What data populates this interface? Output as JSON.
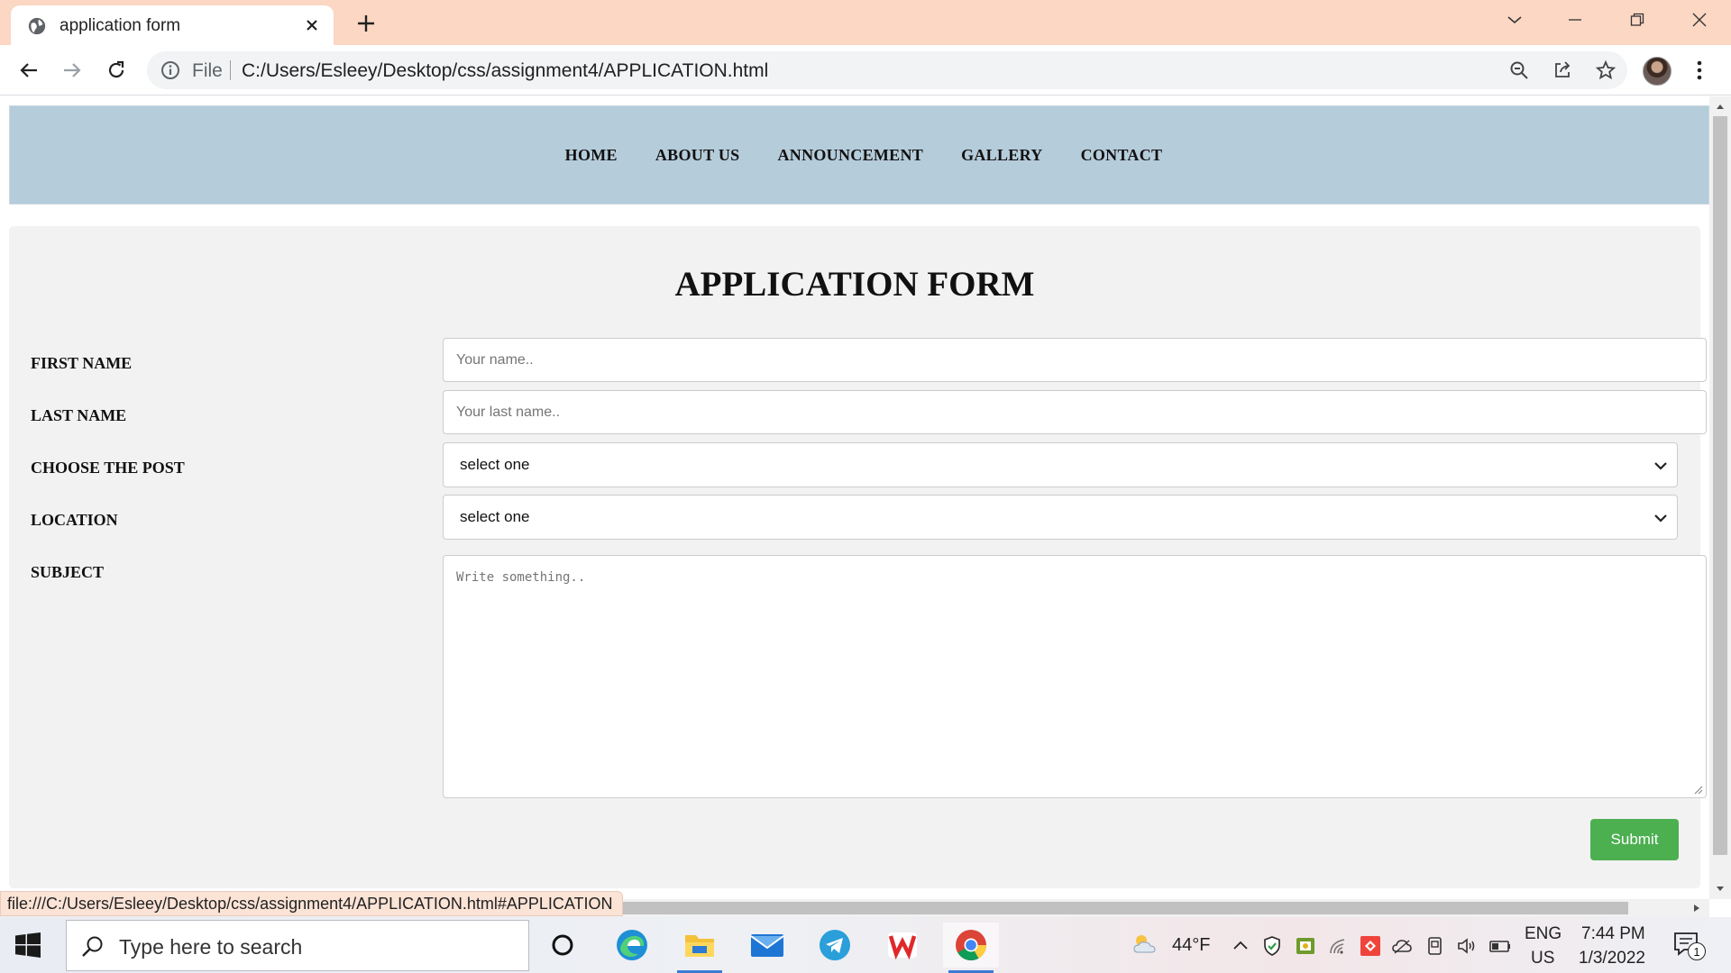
{
  "browser": {
    "tab_title": "application form",
    "omnibox_scheme_label": "File",
    "url": "C:/Users/Esleey/Desktop/css/assignment4/APPLICATION.html",
    "status_url": "file:///C:/Users/Esleey/Desktop/css/assignment4/APPLICATION.html#APPLICATION"
  },
  "nav": {
    "links": [
      "HOME",
      "ABOUT US",
      "ANNOUNCEMENT",
      "GALLERY",
      "CONTACT"
    ]
  },
  "form": {
    "title": "APPLICATION FORM",
    "first_name_label": "FIRST NAME",
    "first_name_placeholder": "Your name..",
    "last_name_label": "LAST NAME",
    "last_name_placeholder": "Your last name..",
    "post_label": "CHOOSE THE POST",
    "post_selected": "select one",
    "location_label": "LOCATION",
    "location_selected": "select one",
    "subject_label": "SUBJECT",
    "subject_placeholder": "Write something..",
    "submit_label": "Submit"
  },
  "taskbar": {
    "search_placeholder": "Type here to search",
    "weather": "44°F",
    "lang_primary": "ENG",
    "lang_region": "US",
    "time": "7:44 PM",
    "date": "1/3/2022",
    "notification_count": "1"
  },
  "colors": {
    "tabstrip": "#fbd7c4",
    "navbar": "#b5ccda",
    "form_bg": "#f2f2f2",
    "submit": "#4caf50"
  }
}
